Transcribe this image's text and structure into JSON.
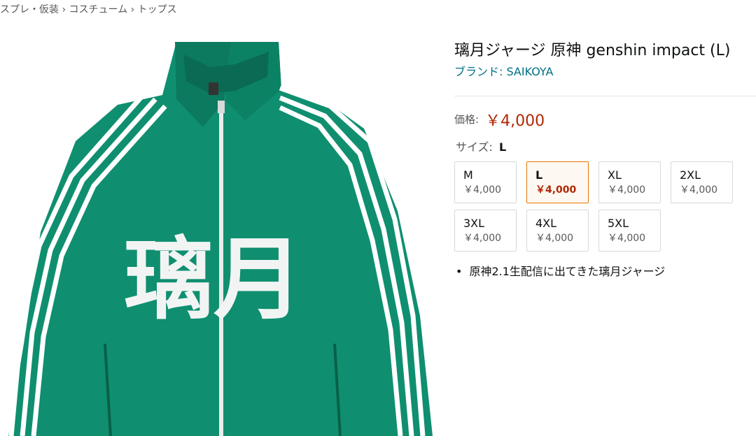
{
  "breadcrumb": "スプレ・仮装 › コスチューム › トップス",
  "product": {
    "title": "璃月ジャージ 原神 genshin impact (L)",
    "brand": "ブランド: SAIKOYA",
    "price_label": "価格:",
    "price": "￥4,000",
    "size_label": "サイズ:",
    "size_selected": "L",
    "image_text": "璃月",
    "jacket_color": "#0f8f6f",
    "selected_border_color": "#e77600",
    "price_color": "#b12704",
    "brand_color": "#007185"
  },
  "sizes": [
    {
      "name": "M",
      "price": "￥4,000"
    },
    {
      "name": "L",
      "price": "￥4,000"
    },
    {
      "name": "XL",
      "price": "￥4,000"
    },
    {
      "name": "2XL",
      "price": "￥4,000"
    },
    {
      "name": "3XL",
      "price": "￥4,000"
    },
    {
      "name": "4XL",
      "price": "￥4,000"
    },
    {
      "name": "5XL",
      "price": "￥4,000"
    }
  ],
  "bullets": [
    "原神2.1生配信に出てきた璃月ジャージ"
  ]
}
